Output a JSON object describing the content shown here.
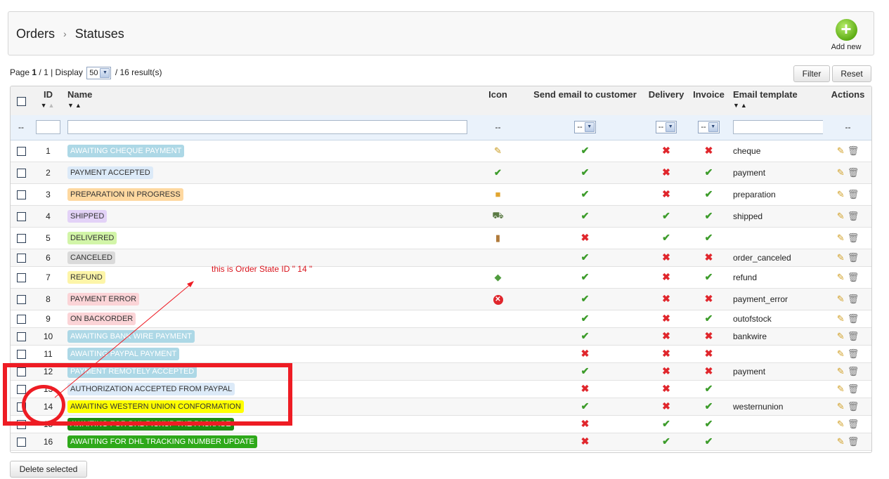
{
  "breadcrumb": {
    "parent": "Orders",
    "separator": ">",
    "current": "Statuses"
  },
  "toolbar": {
    "add_new_label": "Add new",
    "filter_label": "Filter",
    "reset_label": "Reset"
  },
  "pager": {
    "page_label": "Page",
    "page_current": "1",
    "page_total": " / 1",
    "display_label": " | Display",
    "per_page": "50",
    "result_text": "/ 16 result(s)"
  },
  "table": {
    "headers": {
      "id": "ID",
      "name": "Name",
      "icon": "Icon",
      "send_email": "Send email to customer",
      "delivery": "Delivery",
      "invoice": "Invoice",
      "template": "Email template",
      "actions": "Actions"
    },
    "filter": {
      "dash": "--",
      "select_value": "--"
    },
    "rows": [
      {
        "id": "1",
        "name": "AWAITING CHEQUE PAYMENT",
        "color": "#add8e6",
        "text_color": "#ffffff",
        "icon": "cheque-icon",
        "send_email": true,
        "delivery": false,
        "invoice": false,
        "template": "cheque"
      },
      {
        "id": "2",
        "name": "PAYMENT ACCEPTED",
        "color": "#dceaf8",
        "text_color": "#333333",
        "icon": "accepted-icon",
        "send_email": true,
        "delivery": false,
        "invoice": true,
        "template": "payment"
      },
      {
        "id": "3",
        "name": "PREPARATION IN PROGRESS",
        "color": "#fed8a0",
        "text_color": "#333333",
        "icon": "box-icon",
        "send_email": true,
        "delivery": false,
        "invoice": true,
        "template": "preparation"
      },
      {
        "id": "4",
        "name": "SHIPPED",
        "color": "#e3d2f7",
        "text_color": "#333333",
        "icon": "truck-icon",
        "send_email": true,
        "delivery": true,
        "invoice": true,
        "template": "shipped"
      },
      {
        "id": "5",
        "name": "DELIVERED",
        "color": "#d2f5a8",
        "text_color": "#333333",
        "icon": "door-icon",
        "send_email": false,
        "delivery": true,
        "invoice": true,
        "template": ""
      },
      {
        "id": "6",
        "name": "CANCELED",
        "color": "#dadada",
        "text_color": "#333333",
        "icon": "",
        "send_email": true,
        "delivery": false,
        "invoice": false,
        "template": "order_canceled"
      },
      {
        "id": "7",
        "name": "REFUND",
        "color": "#fdf5a8",
        "text_color": "#333333",
        "icon": "refund-icon",
        "send_email": true,
        "delivery": false,
        "invoice": true,
        "template": "refund"
      },
      {
        "id": "8",
        "name": "PAYMENT ERROR",
        "color": "#fbd4d7",
        "text_color": "#333333",
        "icon": "error-icon",
        "send_email": true,
        "delivery": false,
        "invoice": false,
        "template": "payment_error"
      },
      {
        "id": "9",
        "name": "ON BACKORDER",
        "color": "#fbd4d7",
        "text_color": "#333333",
        "icon": "",
        "send_email": true,
        "delivery": false,
        "invoice": true,
        "template": "outofstock"
      },
      {
        "id": "10",
        "name": "AWAITING BANK WIRE PAYMENT",
        "color": "#add8e6",
        "text_color": "#ffffff",
        "icon": "",
        "send_email": true,
        "delivery": false,
        "invoice": false,
        "template": "bankwire"
      },
      {
        "id": "11",
        "name": "AWAITING PAYPAL PAYMENT",
        "color": "#add8e6",
        "text_color": "#ffffff",
        "icon": "",
        "send_email": false,
        "delivery": false,
        "invoice": false,
        "template": ""
      },
      {
        "id": "12",
        "name": "PAYMENT REMOTELY ACCEPTED",
        "color": "#add8e6",
        "text_color": "#ffffff",
        "icon": "",
        "send_email": true,
        "delivery": false,
        "invoice": false,
        "template": "payment"
      },
      {
        "id": "13",
        "name": "AUTHORIZATION ACCEPTED FROM PAYPAL",
        "color": "#dceaf8",
        "text_color": "#333333",
        "icon": "",
        "send_email": false,
        "delivery": false,
        "invoice": true,
        "template": ""
      },
      {
        "id": "14",
        "name": "AWAITING WESTERN UNION CONFORMATION",
        "color": "#ffff00",
        "text_color": "#333333",
        "icon": "",
        "send_email": true,
        "delivery": false,
        "invoice": true,
        "template": "westernunion"
      },
      {
        "id": "15",
        "name": "AWAITING FOR DHL PICKUP THE PACKAGE",
        "color": "#1e8a12",
        "text_color": "#ffffff",
        "icon": "",
        "send_email": false,
        "delivery": true,
        "invoice": true,
        "template": ""
      },
      {
        "id": "16",
        "name": "AWAITING FOR DHL TRACKING NUMBER UPDATE",
        "color": "#2ea91a",
        "text_color": "#ffffff",
        "icon": "",
        "send_email": false,
        "delivery": true,
        "invoice": true,
        "template": ""
      }
    ]
  },
  "footer": {
    "delete_selected_label": "Delete selected"
  },
  "annotation": {
    "text": "this is Order State ID \" 14 \"",
    "color": "#ee1c24"
  },
  "colors": {
    "check": "#3d9c2b",
    "cross": "#e0262c",
    "filter_bg": "#eaf2fb",
    "header_bg": "#f2f2f2"
  }
}
